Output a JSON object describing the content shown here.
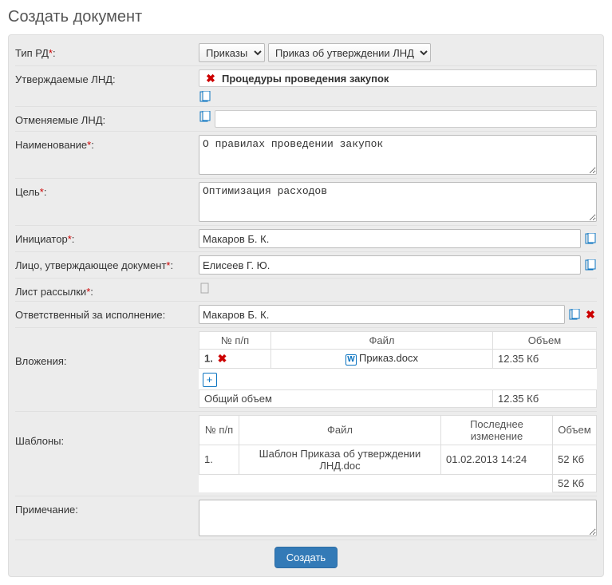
{
  "title": "Создать документ",
  "labels": {
    "tip_rd": "Тип РД",
    "utv_lnd": "Утверждаемые ЛНД:",
    "otm_lnd": "Отменяемые ЛНД:",
    "naimen": "Наименование",
    "tsel": "Цель",
    "initiator": "Инициатор",
    "approver": "Лицо, утверждающее документ",
    "list_rass": "Лист рассылки",
    "responsible": "Ответственный за исполнение:",
    "vlozh": "Вложения:",
    "shablony": "Шаблоны:",
    "primechanie": "Примечание:"
  },
  "values": {
    "tip_rd_1": "Приказы",
    "tip_rd_2": "Приказ об утверждении ЛНД",
    "utv_lnd_item": "Процедуры проведения закупок",
    "naimen": "О правилах проведении закупок",
    "tsel": "Оптимизация расходов",
    "initiator": "Макаров Б. К.",
    "approver": "Елисеев Г. Ю.",
    "responsible": "Макаров Б. К."
  },
  "attachments": {
    "headers": {
      "npp": "№ п/п",
      "file": "Файл",
      "volume": "Объем"
    },
    "rows": [
      {
        "n": "1.",
        "file": "Приказ.docx",
        "size": "12.35 Кб"
      }
    ],
    "total_label": "Общий объем",
    "total_value": "12.35 Кб"
  },
  "templates": {
    "headers": {
      "npp": "№ п/п",
      "file": "Файл",
      "modified": "Последнее изменение",
      "volume": "Объем"
    },
    "rows": [
      {
        "n": "1.",
        "file": "Шаблон Приказа об утверждении ЛНД.doc",
        "modified": "01.02.2013 14:24",
        "size": "52 Кб"
      }
    ],
    "total_value": "52 Кб"
  },
  "submit": "Создать"
}
